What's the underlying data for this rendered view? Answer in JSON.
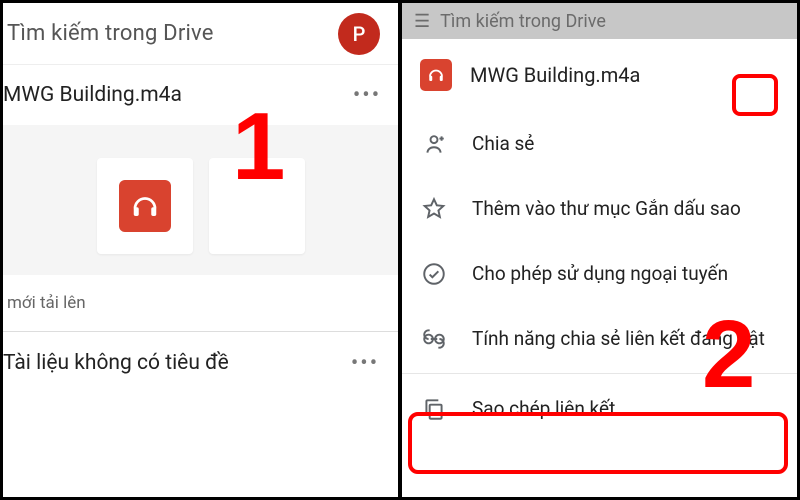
{
  "left": {
    "search_placeholder": "Tìm kiếm trong Drive",
    "avatar_letter": "P",
    "file_name": "MWG Building.m4a",
    "section_recent": "mới tải lên",
    "doc_untitled": "Tài liệu không có tiêu đề",
    "step_number": "1"
  },
  "right": {
    "dim_text": "Tìm kiếm trong Drive",
    "file_name": "MWG Building.m4a",
    "menu": {
      "share": "Chia sẻ",
      "star": "Thêm vào thư mục Gắn dấu sao",
      "offline": "Cho phép sử dụng ngoại tuyến",
      "link_on": "Tính năng chia sẻ liên kết đang bật",
      "copy_link": "Sao chép liên kết"
    },
    "step_number": "2"
  }
}
